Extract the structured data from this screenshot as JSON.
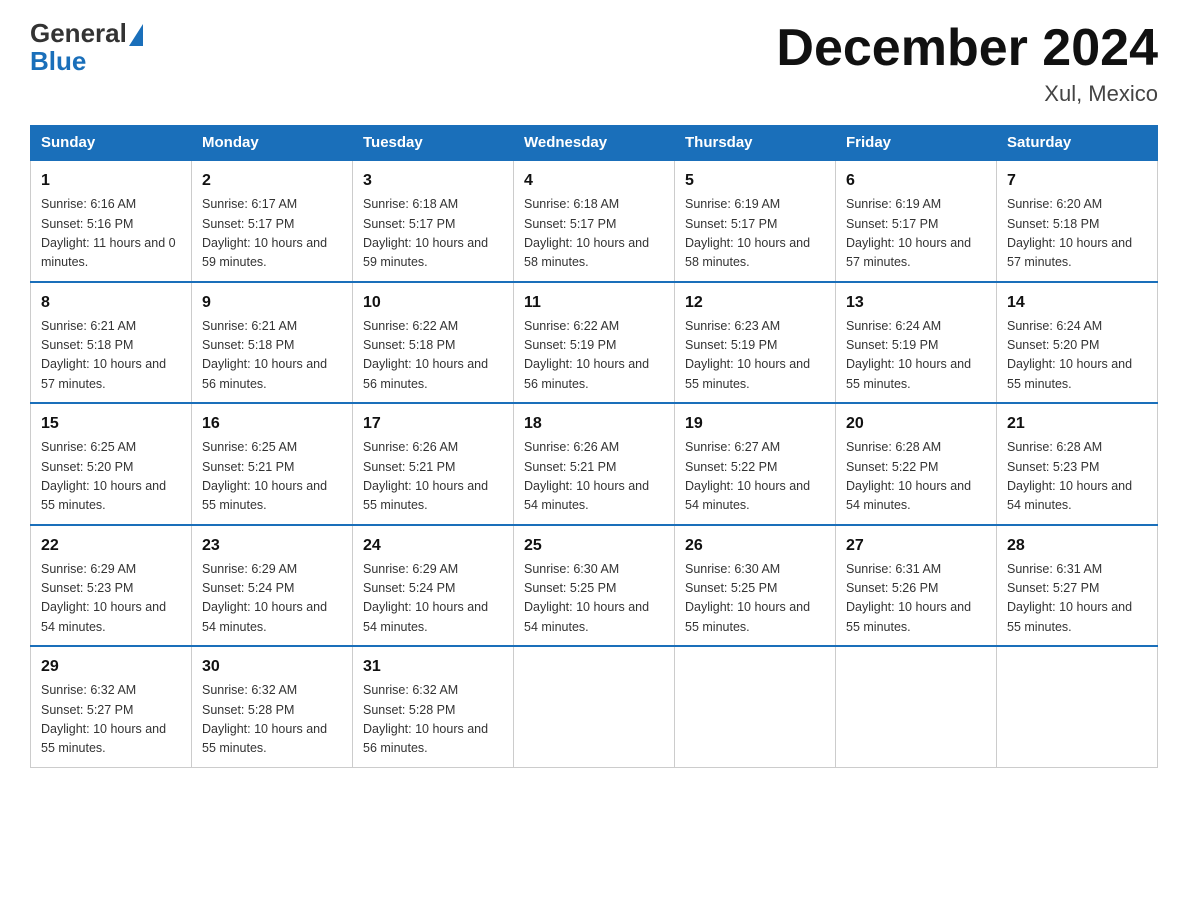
{
  "header": {
    "logo_general": "General",
    "logo_blue": "Blue",
    "month_title": "December 2024",
    "location": "Xul, Mexico"
  },
  "days_of_week": [
    "Sunday",
    "Monday",
    "Tuesday",
    "Wednesday",
    "Thursday",
    "Friday",
    "Saturday"
  ],
  "weeks": [
    [
      {
        "num": "1",
        "sunrise": "6:16 AM",
        "sunset": "5:16 PM",
        "daylight": "11 hours and 0 minutes."
      },
      {
        "num": "2",
        "sunrise": "6:17 AM",
        "sunset": "5:17 PM",
        "daylight": "10 hours and 59 minutes."
      },
      {
        "num": "3",
        "sunrise": "6:18 AM",
        "sunset": "5:17 PM",
        "daylight": "10 hours and 59 minutes."
      },
      {
        "num": "4",
        "sunrise": "6:18 AM",
        "sunset": "5:17 PM",
        "daylight": "10 hours and 58 minutes."
      },
      {
        "num": "5",
        "sunrise": "6:19 AM",
        "sunset": "5:17 PM",
        "daylight": "10 hours and 58 minutes."
      },
      {
        "num": "6",
        "sunrise": "6:19 AM",
        "sunset": "5:17 PM",
        "daylight": "10 hours and 57 minutes."
      },
      {
        "num": "7",
        "sunrise": "6:20 AM",
        "sunset": "5:18 PM",
        "daylight": "10 hours and 57 minutes."
      }
    ],
    [
      {
        "num": "8",
        "sunrise": "6:21 AM",
        "sunset": "5:18 PM",
        "daylight": "10 hours and 57 minutes."
      },
      {
        "num": "9",
        "sunrise": "6:21 AM",
        "sunset": "5:18 PM",
        "daylight": "10 hours and 56 minutes."
      },
      {
        "num": "10",
        "sunrise": "6:22 AM",
        "sunset": "5:18 PM",
        "daylight": "10 hours and 56 minutes."
      },
      {
        "num": "11",
        "sunrise": "6:22 AM",
        "sunset": "5:19 PM",
        "daylight": "10 hours and 56 minutes."
      },
      {
        "num": "12",
        "sunrise": "6:23 AM",
        "sunset": "5:19 PM",
        "daylight": "10 hours and 55 minutes."
      },
      {
        "num": "13",
        "sunrise": "6:24 AM",
        "sunset": "5:19 PM",
        "daylight": "10 hours and 55 minutes."
      },
      {
        "num": "14",
        "sunrise": "6:24 AM",
        "sunset": "5:20 PM",
        "daylight": "10 hours and 55 minutes."
      }
    ],
    [
      {
        "num": "15",
        "sunrise": "6:25 AM",
        "sunset": "5:20 PM",
        "daylight": "10 hours and 55 minutes."
      },
      {
        "num": "16",
        "sunrise": "6:25 AM",
        "sunset": "5:21 PM",
        "daylight": "10 hours and 55 minutes."
      },
      {
        "num": "17",
        "sunrise": "6:26 AM",
        "sunset": "5:21 PM",
        "daylight": "10 hours and 55 minutes."
      },
      {
        "num": "18",
        "sunrise": "6:26 AM",
        "sunset": "5:21 PM",
        "daylight": "10 hours and 54 minutes."
      },
      {
        "num": "19",
        "sunrise": "6:27 AM",
        "sunset": "5:22 PM",
        "daylight": "10 hours and 54 minutes."
      },
      {
        "num": "20",
        "sunrise": "6:28 AM",
        "sunset": "5:22 PM",
        "daylight": "10 hours and 54 minutes."
      },
      {
        "num": "21",
        "sunrise": "6:28 AM",
        "sunset": "5:23 PM",
        "daylight": "10 hours and 54 minutes."
      }
    ],
    [
      {
        "num": "22",
        "sunrise": "6:29 AM",
        "sunset": "5:23 PM",
        "daylight": "10 hours and 54 minutes."
      },
      {
        "num": "23",
        "sunrise": "6:29 AM",
        "sunset": "5:24 PM",
        "daylight": "10 hours and 54 minutes."
      },
      {
        "num": "24",
        "sunrise": "6:29 AM",
        "sunset": "5:24 PM",
        "daylight": "10 hours and 54 minutes."
      },
      {
        "num": "25",
        "sunrise": "6:30 AM",
        "sunset": "5:25 PM",
        "daylight": "10 hours and 54 minutes."
      },
      {
        "num": "26",
        "sunrise": "6:30 AM",
        "sunset": "5:25 PM",
        "daylight": "10 hours and 55 minutes."
      },
      {
        "num": "27",
        "sunrise": "6:31 AM",
        "sunset": "5:26 PM",
        "daylight": "10 hours and 55 minutes."
      },
      {
        "num": "28",
        "sunrise": "6:31 AM",
        "sunset": "5:27 PM",
        "daylight": "10 hours and 55 minutes."
      }
    ],
    [
      {
        "num": "29",
        "sunrise": "6:32 AM",
        "sunset": "5:27 PM",
        "daylight": "10 hours and 55 minutes."
      },
      {
        "num": "30",
        "sunrise": "6:32 AM",
        "sunset": "5:28 PM",
        "daylight": "10 hours and 55 minutes."
      },
      {
        "num": "31",
        "sunrise": "6:32 AM",
        "sunset": "5:28 PM",
        "daylight": "10 hours and 56 minutes."
      },
      null,
      null,
      null,
      null
    ]
  ]
}
